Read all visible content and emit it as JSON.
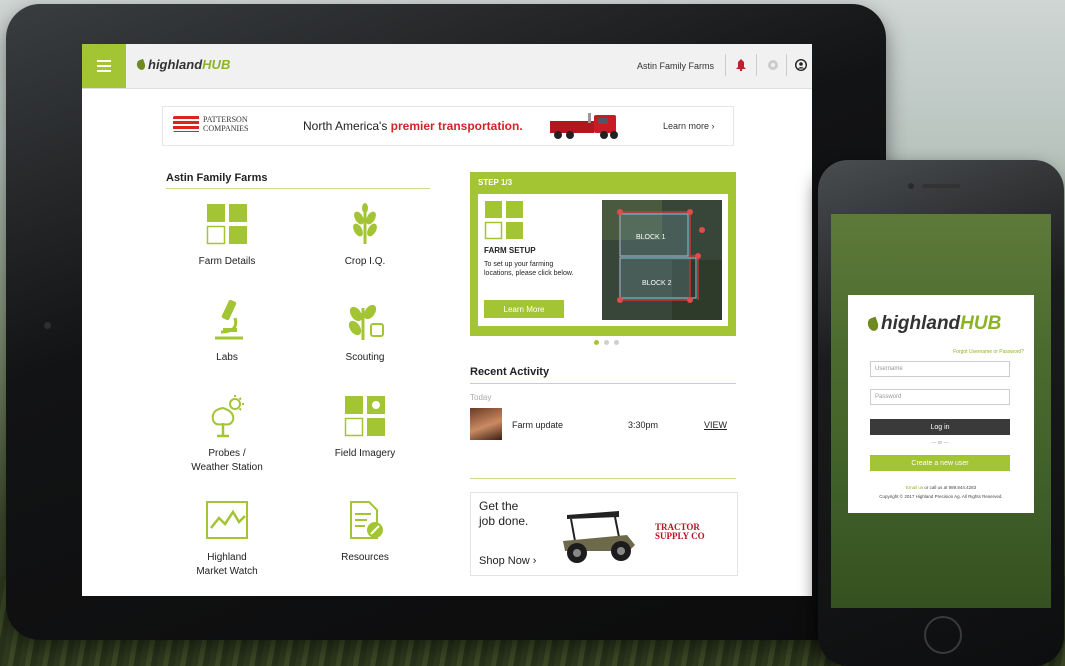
{
  "colors": {
    "brand_green": "#a3c534",
    "accent_red": "#d2232a"
  },
  "header": {
    "logo_main": "highland",
    "logo_hub": "HUB",
    "account_name": "Astin Family Farms",
    "icons": [
      "menu-icon",
      "notifications-icon",
      "settings-icon",
      "user-icon"
    ]
  },
  "banner_ad": {
    "brand_line1": "PATTERSON",
    "brand_line2": "COMPANIES",
    "text_pre": "North America's ",
    "text_bold": "premier transportation.",
    "cta": "Learn more ›"
  },
  "farm": {
    "section_title": "Astin Family Farms",
    "tiles": [
      {
        "label": "Farm Details",
        "icon": "grid-icon"
      },
      {
        "label": "Crop I.Q.",
        "icon": "wheat-icon"
      },
      {
        "label": "Labs",
        "icon": "microscope-icon"
      },
      {
        "label": "Scouting",
        "icon": "plant-icon"
      },
      {
        "label": "Probes /",
        "label2": "Weather Station",
        "icon": "tree-sun-icon"
      },
      {
        "label": "Field Imagery",
        "icon": "camera-grid-icon"
      },
      {
        "label": "Highland",
        "label2": "Market Watch",
        "icon": "chart-icon"
      },
      {
        "label": "Resources",
        "icon": "document-icon"
      }
    ]
  },
  "step_card": {
    "step_label": "STEP 1/3",
    "title": "FARM SETUP",
    "description": "To set up your farming locations, please click below.",
    "button": "Learn More",
    "map_block1": "BLOCK 1",
    "map_block2": "BLOCK 2",
    "carousel_active": 0
  },
  "recent_activity": {
    "title": "Recent Activity",
    "group": "Today",
    "items": [
      {
        "text": "Farm update",
        "time": "3:30pm",
        "action": "VIEW"
      }
    ]
  },
  "ad2": {
    "line1": "Get the",
    "line2": "job done.",
    "cta": "Shop Now ›",
    "brand_line1": "TRACTOR",
    "brand_line2": "SUPPLY CO"
  },
  "phone": {
    "logo_main": "highland",
    "logo_hub": "HUB",
    "forgot": "Forgot Username or Password?",
    "username_placeholder": "Username",
    "password_placeholder": "Password",
    "login_button": "Log in",
    "or": "— or —",
    "create_button": "Create a new user",
    "footer_line1_link": "Email us",
    "footer_line1_rest": " or call us at 989.844.4283",
    "footer_line2": "Copyright © 2017 Highland Precision Ag. All Rights Reserved."
  }
}
